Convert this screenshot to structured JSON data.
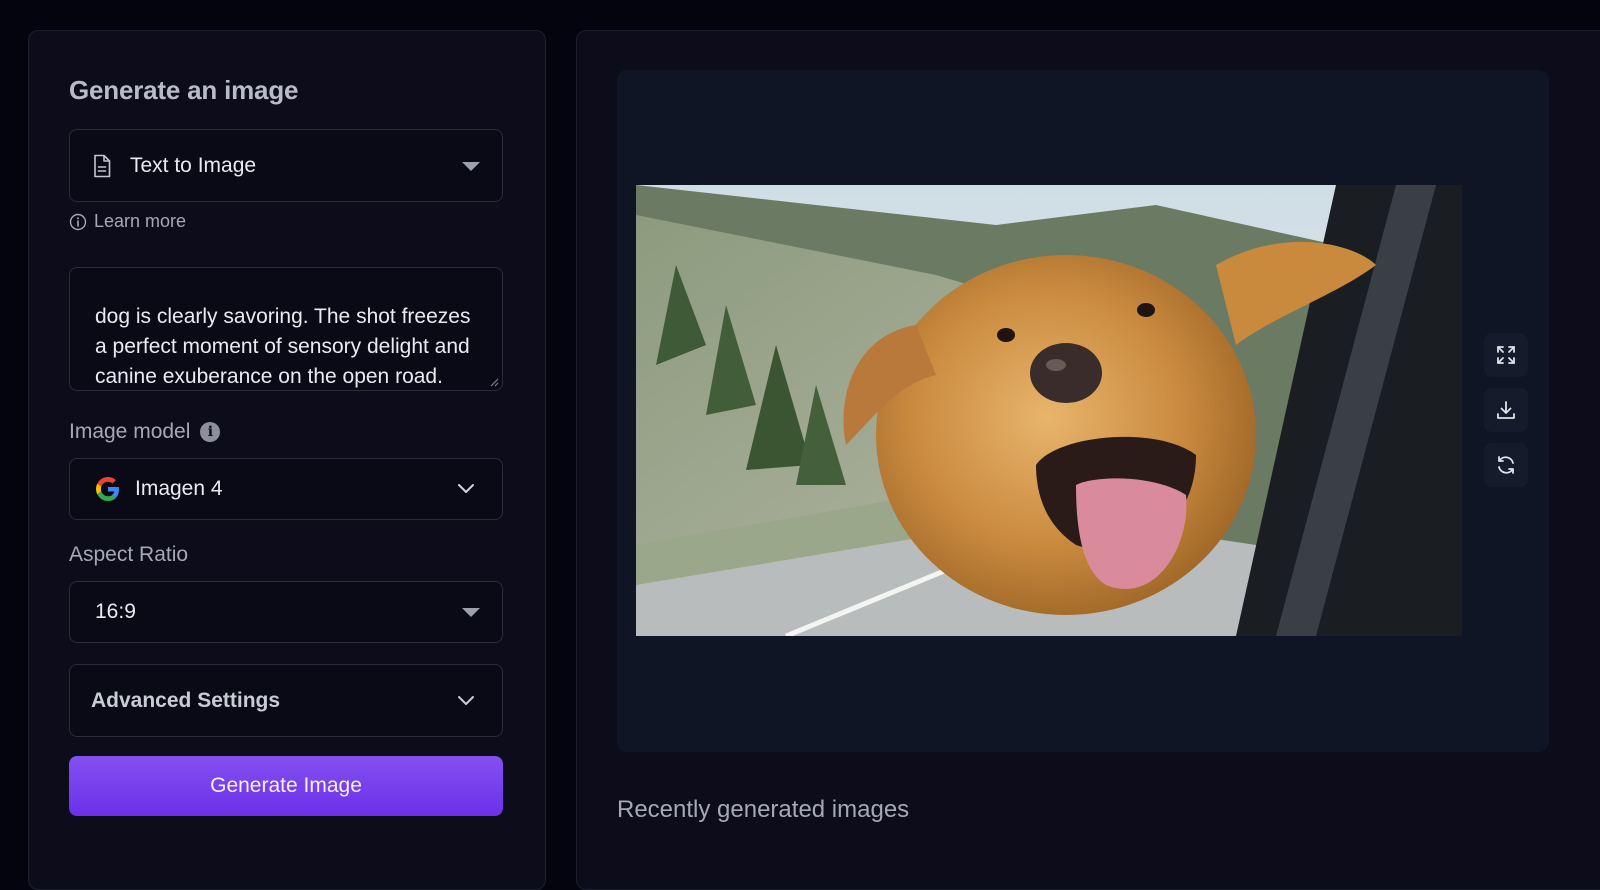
{
  "left": {
    "title": "Generate an image",
    "mode": {
      "selected": "Text to Image",
      "icon": "document-icon"
    },
    "learn_more": "Learn more",
    "prompt": {
      "text": "dog is clearly savoring. The shot freezes a perfect moment of sensory delight and canine exuberance on the open road."
    },
    "image_model": {
      "label": "Image model",
      "info": "i",
      "selected": "Imagen 4",
      "icon": "google-g-icon"
    },
    "aspect_ratio": {
      "label": "Aspect Ratio",
      "selected": "16:9"
    },
    "advanced": {
      "label": "Advanced Settings"
    },
    "generate": {
      "label": "Generate Image"
    }
  },
  "right": {
    "tools": [
      "expand-icon",
      "download-icon",
      "regenerate-icon"
    ],
    "recent_title": "Recently generated images"
  },
  "colors": {
    "accent": "#7a42ee",
    "background": "#04040f",
    "panel": "#0c0c1a"
  }
}
